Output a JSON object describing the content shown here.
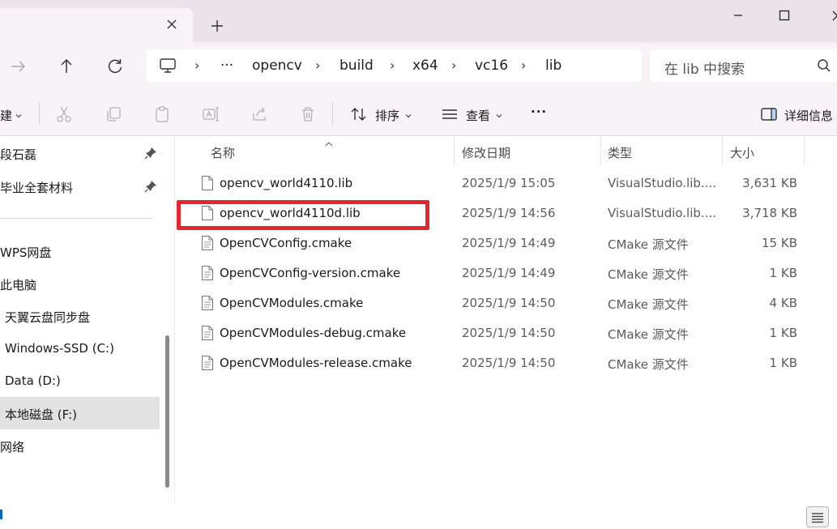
{
  "window": {
    "new_tab_symbol": "+"
  },
  "breadcrumb": {
    "more": "···",
    "separator": "›",
    "items": [
      "opencv",
      "build",
      "x64",
      "vc16",
      "lib"
    ]
  },
  "search": {
    "placeholder": "在 lib 中搜索"
  },
  "command_bar": {
    "new_partial": "建",
    "sort_label": "排序",
    "view_label": "查看",
    "more_label": "···",
    "details_label": "详细信息"
  },
  "sidebar": {
    "pinned": [
      {
        "label": "段石磊"
      },
      {
        "label": "毕业全套材料"
      }
    ],
    "items": [
      {
        "label": "WPS网盘"
      },
      {
        "label": "此电脑"
      },
      {
        "label": "天翼云盘同步盘"
      },
      {
        "label": "Windows-SSD (C:)"
      },
      {
        "label": "Data (D:)"
      },
      {
        "label": "本地磁盘 (F:)",
        "selected": true
      },
      {
        "label": "网络"
      }
    ]
  },
  "columns": {
    "name": "名称",
    "date": "修改日期",
    "type": "类型",
    "size": "大小"
  },
  "files": [
    {
      "name": "opencv_world4110.lib",
      "date": "2025/1/9 15:05",
      "type": "VisualStudio.lib....",
      "size": "3,631 KB"
    },
    {
      "name": "opencv_world4110d.lib",
      "date": "2025/1/9 14:56",
      "type": "VisualStudio.lib....",
      "size": "3,718 KB",
      "highlighted": true
    },
    {
      "name": "OpenCVConfig.cmake",
      "date": "2025/1/9 14:49",
      "type": "CMake 源文件",
      "size": "15 KB"
    },
    {
      "name": "OpenCVConfig-version.cmake",
      "date": "2025/1/9 14:49",
      "type": "CMake 源文件",
      "size": "1 KB"
    },
    {
      "name": "OpenCVModules.cmake",
      "date": "2025/1/9 14:50",
      "type": "CMake 源文件",
      "size": "4 KB"
    },
    {
      "name": "OpenCVModules-debug.cmake",
      "date": "2025/1/9 14:50",
      "type": "CMake 源文件",
      "size": "1 KB"
    },
    {
      "name": "OpenCVModules-release.cmake",
      "date": "2025/1/9 14:50",
      "type": "CMake 源文件",
      "size": "1 KB"
    }
  ],
  "colors": {
    "highlight_border": "#e4262f",
    "titlebar_bg": "#ebe3ea",
    "toolbar_bg": "#f7f3f7",
    "selected_bg": "#e2e2e2"
  }
}
